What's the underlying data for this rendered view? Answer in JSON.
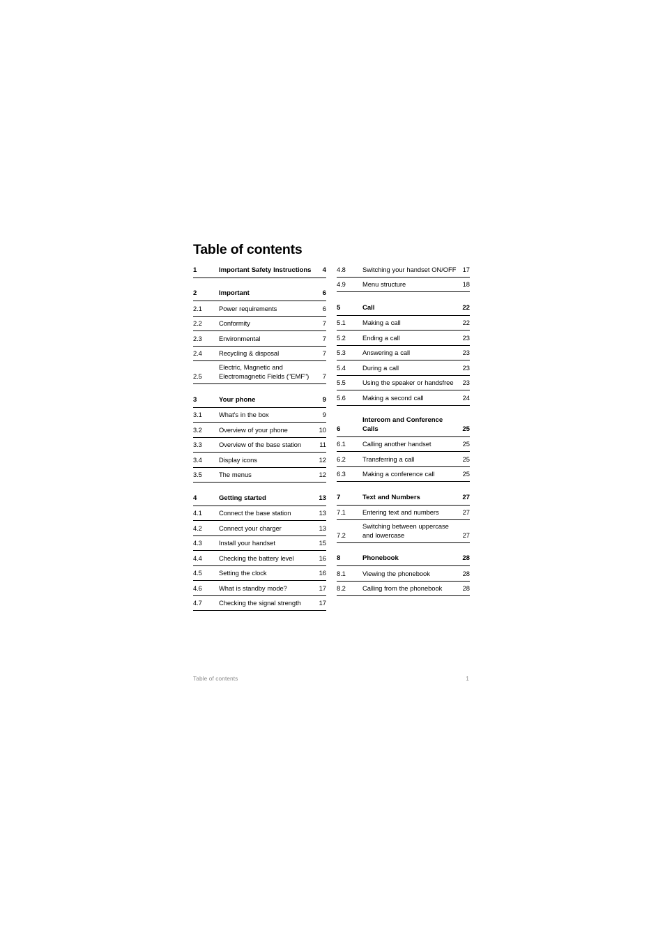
{
  "document": {
    "title": "Table of contents"
  },
  "footer": {
    "label": "Table of contents",
    "page_number": "1"
  },
  "toc": {
    "left_column": [
      {
        "number": "1",
        "label": "Important Safety Instructions",
        "page": "4",
        "level": "chapter",
        "spaced": false
      },
      {
        "number": "2",
        "label": "Important",
        "page": "6",
        "level": "chapter",
        "spaced": true
      },
      {
        "number": "2.1",
        "label": "Power requirements",
        "page": "6",
        "level": "section",
        "spaced": false
      },
      {
        "number": "2.2",
        "label": "Conformity",
        "page": "7",
        "level": "section",
        "spaced": false
      },
      {
        "number": "2.3",
        "label": "Environmental",
        "page": "7",
        "level": "section",
        "spaced": false
      },
      {
        "number": "2.4",
        "label": "Recycling & disposal",
        "page": "7",
        "level": "section",
        "spaced": false
      },
      {
        "number": "2.5",
        "label": "Electric, Magnetic and Electromagnetic Fields (\"EMF\")",
        "page": "7",
        "level": "section",
        "spaced": false
      },
      {
        "number": "3",
        "label": "Your phone",
        "page": "9",
        "level": "chapter",
        "spaced": true
      },
      {
        "number": "3.1",
        "label": "What's in the box",
        "page": "9",
        "level": "section",
        "spaced": false
      },
      {
        "number": "3.2",
        "label": "Overview of your phone",
        "page": "10",
        "level": "section",
        "spaced": false
      },
      {
        "number": "3.3",
        "label": "Overview of the base station",
        "page": "11",
        "level": "section",
        "spaced": false
      },
      {
        "number": "3.4",
        "label": "Display icons",
        "page": "12",
        "level": "section",
        "spaced": false
      },
      {
        "number": "3.5",
        "label": "The menus",
        "page": "12",
        "level": "section",
        "spaced": false
      },
      {
        "number": "4",
        "label": "Getting started",
        "page": "13",
        "level": "chapter",
        "spaced": true
      },
      {
        "number": "4.1",
        "label": "Connect the base station",
        "page": "13",
        "level": "section",
        "spaced": false
      },
      {
        "number": "4.2",
        "label": "Connect your charger",
        "page": "13",
        "level": "section",
        "spaced": false
      },
      {
        "number": "4.3",
        "label": "Install your handset",
        "page": "15",
        "level": "section",
        "spaced": false
      },
      {
        "number": "4.4",
        "label": "Checking the battery level",
        "page": "16",
        "level": "section",
        "spaced": false
      },
      {
        "number": "4.5",
        "label": "Setting the clock",
        "page": "16",
        "level": "section",
        "spaced": false
      },
      {
        "number": "4.6",
        "label": "What is standby mode?",
        "page": "17",
        "level": "section",
        "spaced": false
      },
      {
        "number": "4.7",
        "label": "Checking the signal strength",
        "page": "17",
        "level": "section",
        "spaced": false
      }
    ],
    "right_column": [
      {
        "number": "4.8",
        "label": "Switching your handset ON/OFF",
        "page": "17",
        "level": "section",
        "spaced": false
      },
      {
        "number": "4.9",
        "label": "Menu structure",
        "page": "18",
        "level": "section",
        "spaced": false
      },
      {
        "number": "5",
        "label": "Call",
        "page": "22",
        "level": "chapter",
        "spaced": true
      },
      {
        "number": "5.1",
        "label": "Making a call",
        "page": "22",
        "level": "section",
        "spaced": false
      },
      {
        "number": "5.2",
        "label": "Ending a call",
        "page": "23",
        "level": "section",
        "spaced": false
      },
      {
        "number": "5.3",
        "label": "Answering a call",
        "page": "23",
        "level": "section",
        "spaced": false
      },
      {
        "number": "5.4",
        "label": "During a call",
        "page": "23",
        "level": "section",
        "spaced": false
      },
      {
        "number": "5.5",
        "label": "Using the speaker or handsfree",
        "page": "23",
        "level": "section",
        "spaced": false
      },
      {
        "number": "5.6",
        "label": "Making a second call",
        "page": "24",
        "level": "section",
        "spaced": false
      },
      {
        "number": "6",
        "label": "Intercom and Conference Calls",
        "page": "25",
        "level": "chapter",
        "spaced": true
      },
      {
        "number": "6.1",
        "label": "Calling another handset",
        "page": "25",
        "level": "section",
        "spaced": false
      },
      {
        "number": "6.2",
        "label": "Transferring a call",
        "page": "25",
        "level": "section",
        "spaced": false
      },
      {
        "number": "6.3",
        "label": "Making a conference call",
        "page": "25",
        "level": "section",
        "spaced": false
      },
      {
        "number": "7",
        "label": "Text and Numbers",
        "page": "27",
        "level": "chapter",
        "spaced": true
      },
      {
        "number": "7.1",
        "label": "Entering text and numbers",
        "page": "27",
        "level": "section",
        "spaced": false
      },
      {
        "number": "7.2",
        "label": "Switching between uppercase and lowercase",
        "page": "27",
        "level": "section",
        "spaced": false
      },
      {
        "number": "8",
        "label": "Phonebook",
        "page": "28",
        "level": "chapter",
        "spaced": true
      },
      {
        "number": "8.1",
        "label": "Viewing the phonebook",
        "page": "28",
        "level": "section",
        "spaced": false
      },
      {
        "number": "8.2",
        "label": "Calling from the phonebook",
        "page": "28",
        "level": "section",
        "spaced": false
      }
    ]
  }
}
